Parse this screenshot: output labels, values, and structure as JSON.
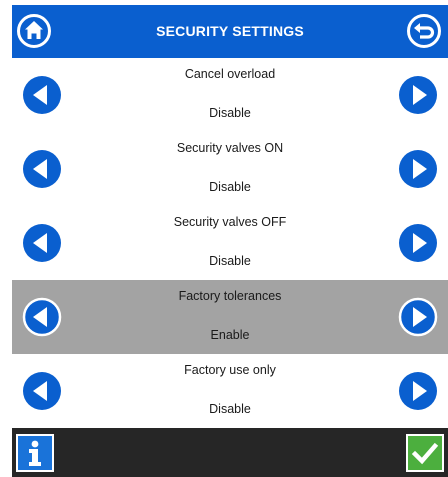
{
  "header": {
    "title": "SECURITY SETTINGS",
    "home_icon": "home-icon",
    "back_icon": "return-icon"
  },
  "rows": [
    {
      "label": "Cancel overload",
      "value": "Disable",
      "selected": false
    },
    {
      "label": "Security valves ON",
      "value": "Disable",
      "selected": false
    },
    {
      "label": "Security valves OFF",
      "value": "Disable",
      "selected": false
    },
    {
      "label": "Factory tolerances",
      "value": "Enable",
      "selected": true
    },
    {
      "label": "Factory use only",
      "value": "Disable",
      "selected": false
    }
  ],
  "footer": {
    "info_icon": "info-icon",
    "confirm_icon": "checkmark-icon"
  },
  "colors": {
    "accent": "#0a5fcf",
    "selected_row": "#a3a3a3",
    "footer": "#262626",
    "confirm": "#4caf3e"
  }
}
